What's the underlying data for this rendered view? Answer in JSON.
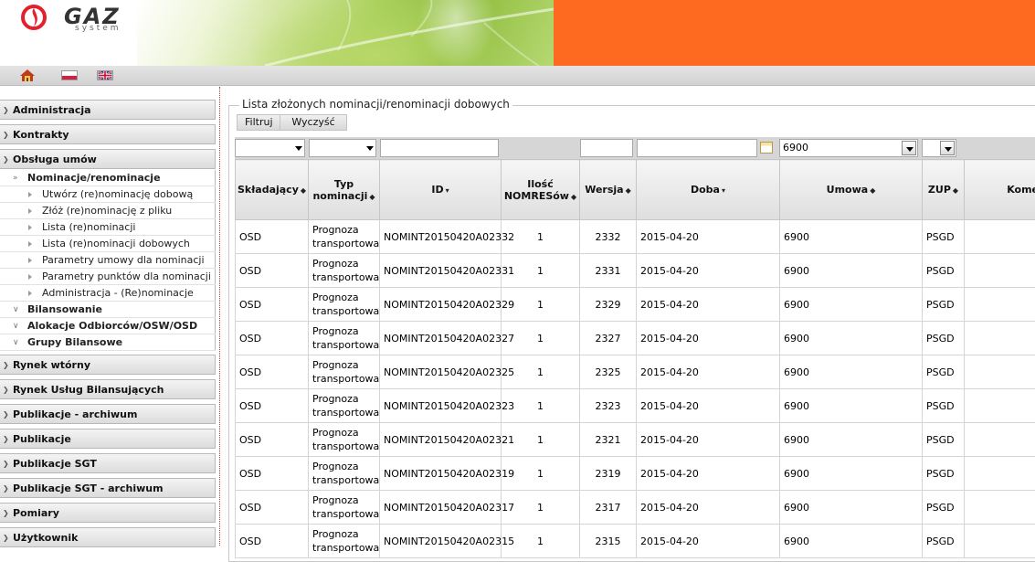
{
  "header": {
    "logo_word": "GAZ",
    "logo_sub": "system"
  },
  "toolbar": {
    "icons": [
      "home-icon",
      "flag-poland-icon",
      "flag-uk-icon"
    ]
  },
  "sidebar": {
    "groups": [
      {
        "label": "Administracja"
      },
      {
        "label": "Kontrakty"
      },
      {
        "label": "Obsługa umów"
      },
      {
        "label": "Rynek wtórny"
      },
      {
        "label": "Rynek Usług Bilansujących"
      },
      {
        "label": "Publikacje - archiwum"
      },
      {
        "label": "Publikacje"
      },
      {
        "label": "Publikacje SGT"
      },
      {
        "label": "Publikacje SGT - archiwum"
      },
      {
        "label": "Pomiary"
      },
      {
        "label": "Użytkownik"
      }
    ],
    "submenu": [
      {
        "label": "Nominacje/renominacje",
        "level": 1
      },
      {
        "label": "Utwórz (re)nominację dobową",
        "level": 2
      },
      {
        "label": "Złóż (re)nominację z pliku",
        "level": 2
      },
      {
        "label": "Lista (re)nominacji",
        "level": 2
      },
      {
        "label": "Lista (re)nominacji dobowych",
        "level": 2
      },
      {
        "label": "Parametry umowy dla nominacji",
        "level": 2
      },
      {
        "label": "Parametry punktów dla nominacji",
        "level": 2
      },
      {
        "label": "Administracja - (Re)nominacje",
        "level": 2
      },
      {
        "label": "Bilansowanie",
        "level": 1
      },
      {
        "label": "Alokacje Odbiorców/OSW/OSD",
        "level": 1
      },
      {
        "label": "Grupy Bilansowe",
        "level": 1
      }
    ]
  },
  "main": {
    "legend": "Lista złożonych nominacji/renominacji dobowych",
    "filter_button": "Filtruj",
    "clear_button": "Wyczyść",
    "filters": {
      "umowa_value": "6900"
    },
    "columns": [
      {
        "label": "Składający",
        "sort": "both"
      },
      {
        "label": "Typ nominacji",
        "sort": "both"
      },
      {
        "label": "ID",
        "sort": "down"
      },
      {
        "label": "Ilość NOMRESów",
        "sort": "both"
      },
      {
        "label": "Wersja",
        "sort": "both"
      },
      {
        "label": "Doba",
        "sort": "down"
      },
      {
        "label": "Umowa",
        "sort": "both"
      },
      {
        "label": "ZUP",
        "sort": "both"
      },
      {
        "label": "Kome",
        "sort": "none"
      }
    ],
    "rows": [
      {
        "skladajacy": "OSD",
        "typ": "Prognoza transportowa",
        "id": "NOMINT20150420A02332",
        "ilosc": "1",
        "wersja": "2332",
        "doba": "2015-04-20",
        "umowa": "6900",
        "zup": "PSGD"
      },
      {
        "skladajacy": "OSD",
        "typ": "Prognoza transportowa",
        "id": "NOMINT20150420A02331",
        "ilosc": "1",
        "wersja": "2331",
        "doba": "2015-04-20",
        "umowa": "6900",
        "zup": "PSGD"
      },
      {
        "skladajacy": "OSD",
        "typ": "Prognoza transportowa",
        "id": "NOMINT20150420A02329",
        "ilosc": "1",
        "wersja": "2329",
        "doba": "2015-04-20",
        "umowa": "6900",
        "zup": "PSGD"
      },
      {
        "skladajacy": "OSD",
        "typ": "Prognoza transportowa",
        "id": "NOMINT20150420A02327",
        "ilosc": "1",
        "wersja": "2327",
        "doba": "2015-04-20",
        "umowa": "6900",
        "zup": "PSGD"
      },
      {
        "skladajacy": "OSD",
        "typ": "Prognoza transportowa",
        "id": "NOMINT20150420A02325",
        "ilosc": "1",
        "wersja": "2325",
        "doba": "2015-04-20",
        "umowa": "6900",
        "zup": "PSGD"
      },
      {
        "skladajacy": "OSD",
        "typ": "Prognoza transportowa",
        "id": "NOMINT20150420A02323",
        "ilosc": "1",
        "wersja": "2323",
        "doba": "2015-04-20",
        "umowa": "6900",
        "zup": "PSGD"
      },
      {
        "skladajacy": "OSD",
        "typ": "Prognoza transportowa",
        "id": "NOMINT20150420A02321",
        "ilosc": "1",
        "wersja": "2321",
        "doba": "2015-04-20",
        "umowa": "6900",
        "zup": "PSGD"
      },
      {
        "skladajacy": "OSD",
        "typ": "Prognoza transportowa",
        "id": "NOMINT20150420A02319",
        "ilosc": "1",
        "wersja": "2319",
        "doba": "2015-04-20",
        "umowa": "6900",
        "zup": "PSGD"
      },
      {
        "skladajacy": "OSD",
        "typ": "Prognoza transportowa",
        "id": "NOMINT20150420A02317",
        "ilosc": "1",
        "wersja": "2317",
        "doba": "2015-04-20",
        "umowa": "6900",
        "zup": "PSGD"
      },
      {
        "skladajacy": "OSD",
        "typ": "Prognoza transportowa",
        "id": "NOMINT20150420A02315",
        "ilosc": "1",
        "wersja": "2315",
        "doba": "2015-04-20",
        "umowa": "6900",
        "zup": "PSGD"
      }
    ]
  },
  "colors": {
    "brand_orange": "#ff6a21",
    "brand_red": "#e3202b",
    "header_bg": "#d6d6d6"
  }
}
